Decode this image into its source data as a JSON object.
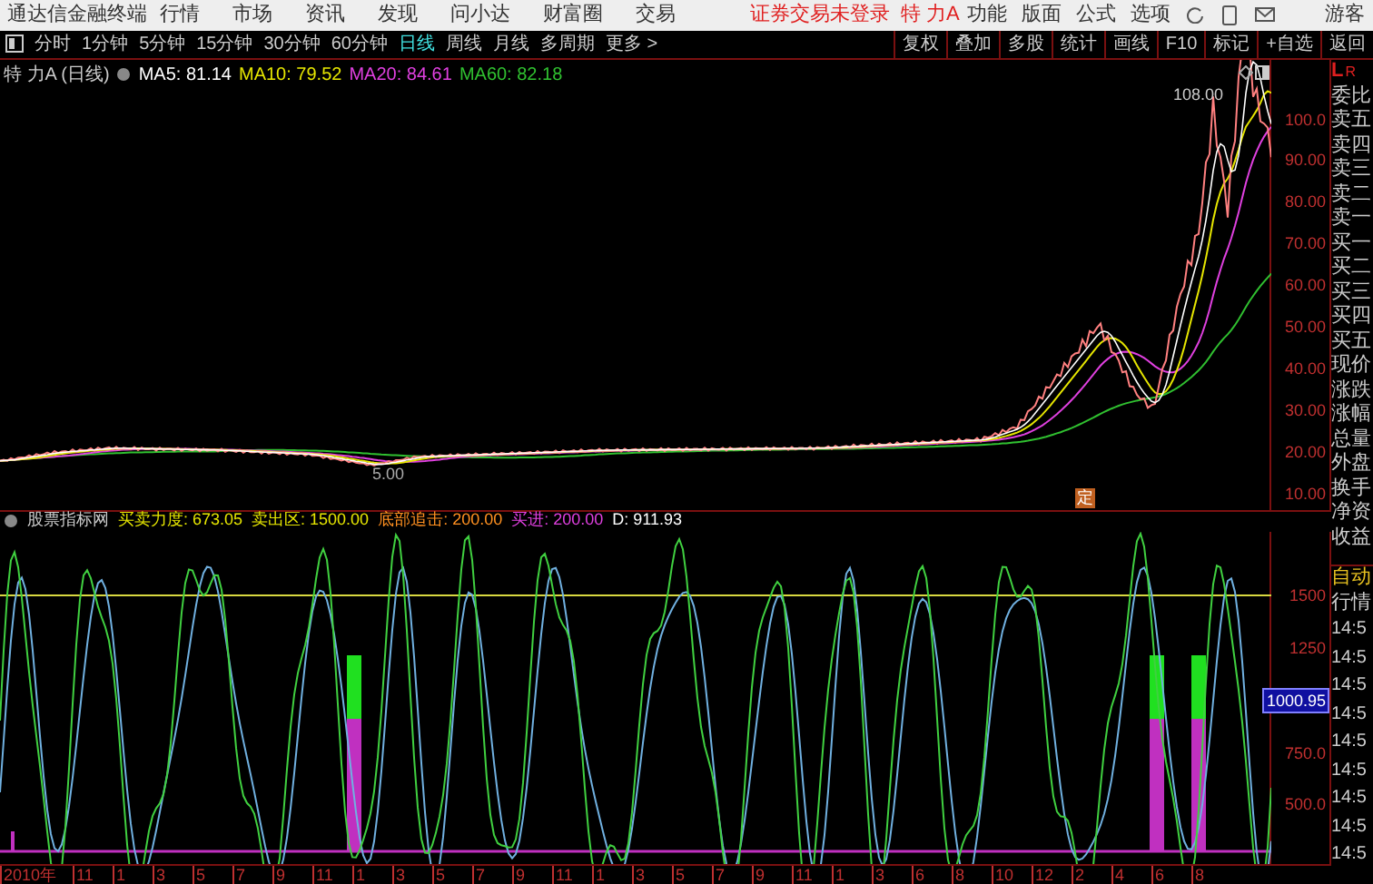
{
  "menu_bar": {
    "app_title": "通达信金融终端",
    "menus": [
      "行情",
      "市场",
      "资讯",
      "发现",
      "问小达",
      "财富圈",
      "交易"
    ],
    "login_notice": "证券交易未登录",
    "stock": "特 力A",
    "actions": [
      "功能",
      "版面",
      "公式",
      "选项"
    ],
    "user": "游客"
  },
  "toolbar": {
    "periods": [
      {
        "label": "分时",
        "selected": false
      },
      {
        "label": "1分钟",
        "selected": false
      },
      {
        "label": "5分钟",
        "selected": false
      },
      {
        "label": "15分钟",
        "selected": false
      },
      {
        "label": "30分钟",
        "selected": false
      },
      {
        "label": "60分钟",
        "selected": false
      },
      {
        "label": "日线",
        "selected": true
      },
      {
        "label": "周线",
        "selected": false
      },
      {
        "label": "月线",
        "selected": false
      },
      {
        "label": "多周期",
        "selected": false
      },
      {
        "label": "更多 >",
        "selected": false
      }
    ],
    "tools": [
      "复权",
      "叠加",
      "多股",
      "统计",
      "画线",
      "F10",
      "标记",
      "+自选",
      "返回"
    ]
  },
  "chart": {
    "title": "特 力A (日线)",
    "ma": [
      {
        "label": "MA5: 81.14",
        "color": "#ffffff"
      },
      {
        "label": "MA10: 79.52",
        "color": "#e6e600"
      },
      {
        "label": "MA20: 84.61",
        "color": "#e040e0"
      },
      {
        "label": "MA60: 82.18",
        "color": "#30c030"
      }
    ],
    "price_axis": [
      "100.0",
      "90.00",
      "80.00",
      "70.00",
      "60.00",
      "50.00",
      "40.00",
      "30.00",
      "20.00",
      "10.00"
    ],
    "high_label": "108.00",
    "low_label": "5.00",
    "marker": "定"
  },
  "indicator": {
    "name": "股票指标网",
    "values": [
      {
        "label": "买卖力度: 673.05",
        "color": "#e6e600"
      },
      {
        "label": "卖出区: 1500.00",
        "color": "#e6e600"
      },
      {
        "label": "底部追击: 200.00",
        "color": "#ff9020"
      },
      {
        "label": "买进: 200.00",
        "color": "#e040e0"
      },
      {
        "label": "D: 911.93",
        "color": "#ffffff"
      }
    ],
    "axis": [
      "1500",
      "1250",
      "750.0",
      "500.0"
    ],
    "current": "1000.95"
  },
  "x_axis": [
    "2010年",
    "11",
    "1",
    "3",
    "5",
    "7",
    "9",
    "11",
    "1",
    "3",
    "5",
    "7",
    "9",
    "11",
    "1",
    "3",
    "5",
    "7",
    "9",
    "11",
    "1",
    "3",
    "6",
    "8",
    "10",
    "12",
    "2",
    "4",
    "6",
    "8"
  ],
  "side_panel": {
    "header_left": "L",
    "header_right": "R",
    "quote_labels": [
      "委比",
      "卖五",
      "卖四",
      "卖三",
      "卖二",
      "卖一",
      "买一",
      "买二",
      "买三",
      "买四",
      "买五",
      "现价",
      "涨跌",
      "涨幅",
      "总量",
      "外盘",
      "换手",
      "净资",
      "收益"
    ],
    "auto_label": "自动",
    "quote_tab": "行情",
    "times": [
      "14:5",
      "14:5",
      "14:5",
      "14:5",
      "14:5",
      "14:5",
      "14:5",
      "14:5",
      "14:5"
    ]
  }
}
